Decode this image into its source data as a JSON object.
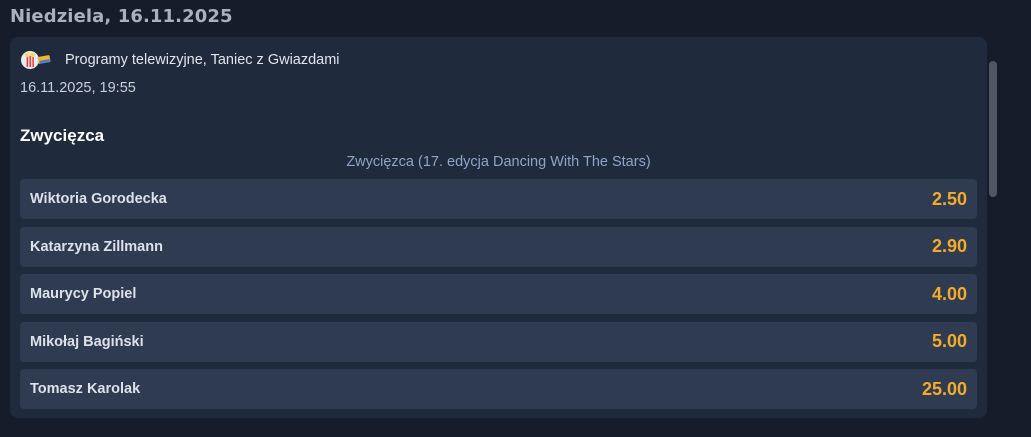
{
  "day_header": "Niedziela, 16.11.2025",
  "event": {
    "category_icon": "tv-popcorn-icon",
    "category": "Programy telewizyjne, Taniec z Gwiazdami",
    "datetime": "16.11.2025, 19:55"
  },
  "market": {
    "title": "Zwycięzca",
    "subtitle": "Zwycięzca (17. edycja Dancing With The Stars)",
    "outcomes": [
      {
        "name": "Wiktoria Gorodecka",
        "odds": "2.50"
      },
      {
        "name": "Katarzyna Zillmann",
        "odds": "2.90"
      },
      {
        "name": "Maurycy Popiel",
        "odds": "4.00"
      },
      {
        "name": "Mikołaj Bagiński",
        "odds": "5.00"
      },
      {
        "name": "Tomasz Karolak",
        "odds": "25.00"
      }
    ]
  },
  "colors": {
    "background": "#161c2a",
    "card": "#1f2a3d",
    "row": "#2e3b51",
    "odds": "#f4ab2c",
    "subtitle": "#8fa4c6"
  }
}
